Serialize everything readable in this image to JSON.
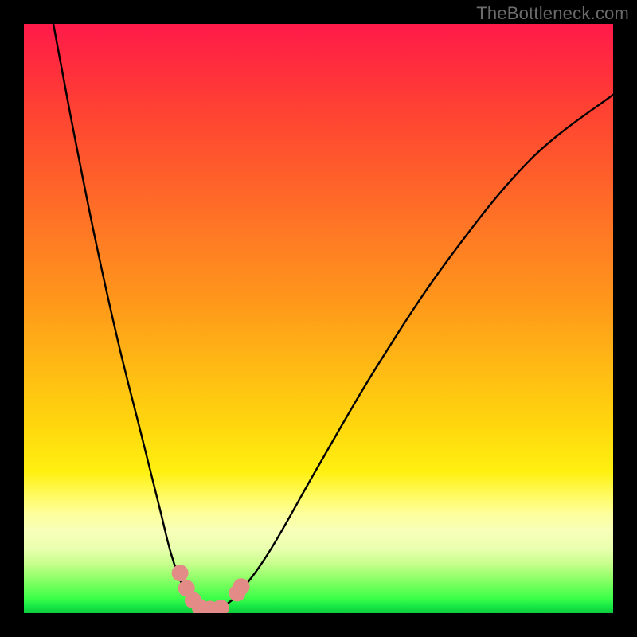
{
  "watermark": {
    "text": "TheBottleneck.com"
  },
  "colors": {
    "frame": "#000000",
    "curve_stroke": "#000000",
    "marker_fill": "#e38b87",
    "marker_stroke": "#d06f6a",
    "watermark": "#6b6b6b"
  },
  "chart_data": {
    "type": "line",
    "title": "",
    "xlabel": "",
    "ylabel": "",
    "xlim": [
      0,
      100
    ],
    "ylim": [
      0,
      100
    ],
    "grid": false,
    "annotations": [
      "TheBottleneck.com"
    ],
    "series": [
      {
        "name": "bottleneck-curve",
        "x": [
          5,
          8,
          12,
          16,
          20,
          23,
          25,
          27,
          29,
          30.5,
          32,
          34,
          37,
          42,
          50,
          60,
          72,
          86,
          100
        ],
        "y": [
          100,
          84,
          64,
          46,
          30,
          18,
          10,
          4.5,
          1.2,
          0,
          0.2,
          1.2,
          4,
          11,
          25,
          42,
          60,
          77,
          88
        ]
      }
    ],
    "markers": [
      {
        "name": "marker-1",
        "x": 26.5,
        "y": 6.8
      },
      {
        "name": "marker-2",
        "x": 27.6,
        "y": 4.2
      },
      {
        "name": "marker-3",
        "x": 28.7,
        "y": 2.2
      },
      {
        "name": "marker-4",
        "x": 29.9,
        "y": 1.0
      },
      {
        "name": "marker-5",
        "x": 31.6,
        "y": 0.7
      },
      {
        "name": "marker-6",
        "x": 33.4,
        "y": 0.9
      },
      {
        "name": "marker-7",
        "x": 36.2,
        "y": 3.4
      },
      {
        "name": "marker-8",
        "x": 36.9,
        "y": 4.5
      }
    ],
    "curve_min": {
      "x": 30.5,
      "y": 0
    }
  }
}
